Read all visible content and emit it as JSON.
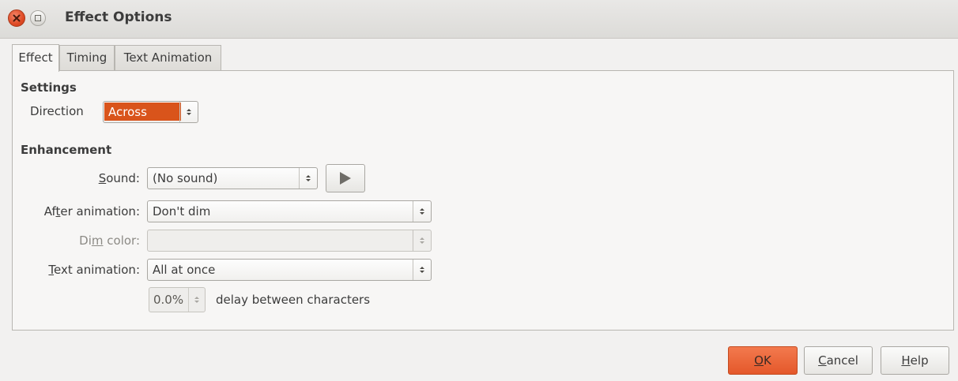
{
  "window": {
    "title": "Effect Options"
  },
  "tabs": [
    {
      "label": "Effect",
      "active": true
    },
    {
      "label": "Timing",
      "active": false
    },
    {
      "label": "Text Animation",
      "active": false
    }
  ],
  "settings": {
    "heading": "Settings",
    "direction_label": "Direction",
    "direction_value": "Across"
  },
  "enhancement": {
    "heading": "Enhancement",
    "sound_label_u": "S",
    "sound_label_rest": "ound:",
    "sound_value": "(No sound)",
    "after_label_a": "Af",
    "after_label_u": "t",
    "after_label_rest": "er animation:",
    "after_value": "Don't dim",
    "dim_label_a": "Di",
    "dim_label_u": "m",
    "dim_label_rest": " color:",
    "dim_value": "",
    "text_label_u": "T",
    "text_label_rest": "ext animation:",
    "text_value": "All at once",
    "delay_value": "0.0%",
    "delay_label": "delay between characters"
  },
  "buttons": {
    "ok_u": "O",
    "ok_rest": "K",
    "cancel_u": "C",
    "cancel_rest": "ancel",
    "help_u": "H",
    "help_rest": "elp"
  },
  "colors": {
    "accent": "#d9541b",
    "ok_button": "#e4582a",
    "close_button": "#df4a25"
  },
  "icons": {
    "close": "close-icon",
    "maximize": "maximize-icon",
    "play": "play-icon",
    "spinner": "spinner-arrows-icon"
  }
}
